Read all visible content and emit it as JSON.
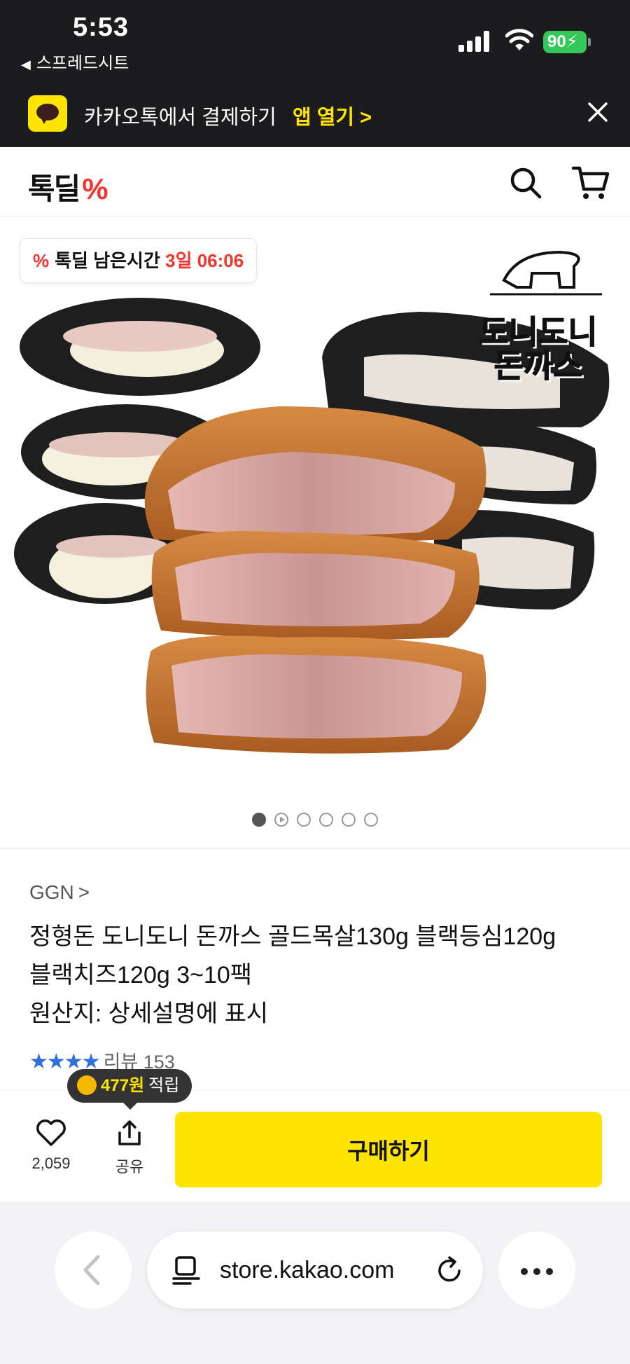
{
  "status_bar": {
    "time": "5:53",
    "back_app": "스프레드시트",
    "battery": "90"
  },
  "kakao_banner": {
    "text": "카카오톡에서 결제하기",
    "open_label": "앱 열기 >"
  },
  "header": {
    "logo_text": "톡딜",
    "logo_mark": "%"
  },
  "hero": {
    "timer_prefix": "톡딜 남은시간",
    "timer_value": "3일 06:06",
    "timer_mark": "%",
    "brand_line1": "도니도니",
    "brand_line2": "돈까스",
    "slides_total": 6,
    "slides_active": 1
  },
  "product": {
    "seller": "GGN",
    "title_line1": "정형돈 도니도니 돈까스 골드목살130g 블랙등심120g",
    "title_line2": "블랙치즈120g 3~10팩",
    "title_line3": "원산지: 상세설명에 표시",
    "rating_stars": "★★★★",
    "review_label": "리뷰 153"
  },
  "points_tooltip": {
    "amount": "477원",
    "label": "적립"
  },
  "purchase_bar": {
    "like_count": "2,059",
    "share_label": "공유",
    "buy_label": "구매하기"
  },
  "browser": {
    "url": "store.kakao.com"
  },
  "colors": {
    "kakao_yellow": "#fee500",
    "tokdeal_red": "#f2342c",
    "star_blue": "#2f6fe0",
    "dark_bar": "#1c1c1e"
  }
}
